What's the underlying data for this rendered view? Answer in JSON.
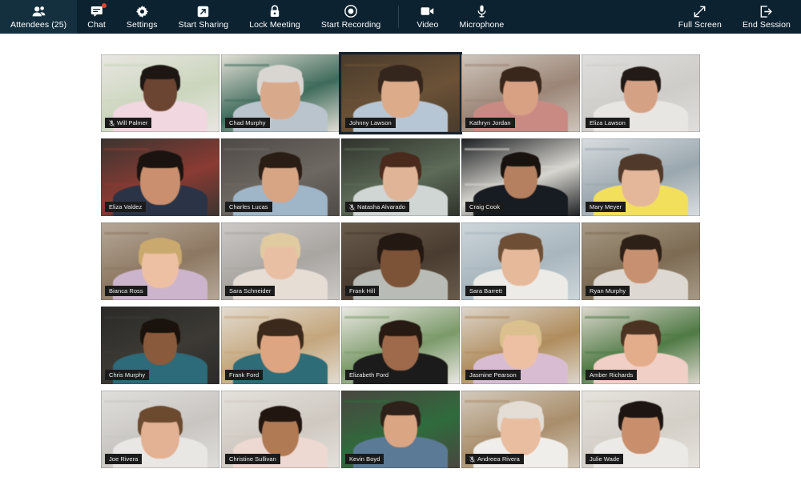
{
  "toolbar": {
    "background_color": "#0c2230",
    "left_items": [
      {
        "label": "Attendees (25)",
        "icon": "attendees-icon",
        "badge": false
      },
      {
        "label": "Chat",
        "icon": "chat-icon",
        "badge": true
      },
      {
        "label": "Settings",
        "icon": "gear-icon",
        "badge": false
      },
      {
        "label": "Start Sharing",
        "icon": "share-screen-icon",
        "badge": false
      },
      {
        "label": "Lock Meeting",
        "icon": "lock-icon",
        "badge": false
      },
      {
        "label": "Start Recording",
        "icon": "record-icon",
        "badge": false
      },
      {
        "label": "Video",
        "icon": "video-camera-icon",
        "badge": false
      },
      {
        "label": "Microphone",
        "icon": "microphone-icon",
        "badge": false
      }
    ],
    "right_items": [
      {
        "label": "Full Screen",
        "icon": "full-screen-icon"
      },
      {
        "label": "End Session",
        "icon": "exit-door-icon"
      }
    ],
    "badge_color": "#e8442e"
  },
  "participants": [
    {
      "name": "Will Palmer",
      "muted": true,
      "active": false,
      "bg": "#e9e6e2",
      "hair": "#1d1612",
      "skin": "#6b4432",
      "shirt": "#f0d7e0",
      "accent": "#cbd6bd"
    },
    {
      "name": "Chad Murphy",
      "muted": false,
      "active": false,
      "bg": "#e4e0d6",
      "hair": "#d9d6d2",
      "skin": "#d9a98c",
      "shirt": "#b9c4cd",
      "accent": "#3f6b5c"
    },
    {
      "name": "Johnny Lawson",
      "muted": false,
      "active": true,
      "bg": "#4a3b2c",
      "hair": "#34261c",
      "skin": "#dcab8a",
      "shirt": "#b7c6d4",
      "accent": "#6b5237"
    },
    {
      "name": "Kathryn Jordan",
      "muted": false,
      "active": false,
      "bg": "#cfc6bc",
      "hair": "#3a271c",
      "skin": "#d9a184",
      "shirt": "#c98a84",
      "accent": "#9b8577"
    },
    {
      "name": "Eliza Lawson",
      "muted": false,
      "active": false,
      "bg": "#dfdedc",
      "hair": "#221a16",
      "skin": "#d5a184",
      "shirt": "#e8e6e3",
      "accent": "#cfcdca"
    },
    {
      "name": "Eliza Valdez",
      "muted": false,
      "active": false,
      "bg": "#3b3531",
      "hair": "#1a1310",
      "skin": "#c98f6e",
      "shirt": "#2a3446",
      "accent": "#8a3b33"
    },
    {
      "name": "Charles Lucas",
      "muted": false,
      "active": false,
      "bg": "#4e4a46",
      "hair": "#2a1d16",
      "skin": "#d7a484",
      "shirt": "#9fb6c9",
      "accent": "#6e6862"
    },
    {
      "name": "Natasha Alvarado",
      "muted": true,
      "active": false,
      "bg": "#30332c",
      "hair": "#4a2a1c",
      "skin": "#e0b497",
      "shirt": "#cfd6d3",
      "accent": "#5d6b58"
    },
    {
      "name": "Craig Cook",
      "muted": false,
      "active": false,
      "bg": "#1d1f22",
      "hair": "#191310",
      "skin": "#b5805f",
      "shirt": "#171b22",
      "accent": "#d8d6d0"
    },
    {
      "name": "Mary Meyer",
      "muted": false,
      "active": false,
      "bg": "#d9dde0",
      "hair": "#50392a",
      "skin": "#e5b79a",
      "shirt": "#f2e05c",
      "accent": "#9aa7ae"
    },
    {
      "name": "Bianca Ross",
      "muted": false,
      "active": false,
      "bg": "#b6a898",
      "hair": "#c9a96e",
      "skin": "#edc0a4",
      "shirt": "#cdb4cd",
      "accent": "#8d7862"
    },
    {
      "name": "Sara Schneider",
      "muted": false,
      "active": false,
      "bg": "#ccc9c6",
      "hair": "#e0cba0",
      "skin": "#e9bfa4",
      "shirt": "#e6ddd5",
      "accent": "#a9a5a1"
    },
    {
      "name": "Frank Hill",
      "muted": false,
      "active": false,
      "bg": "#6a5c4c",
      "hair": "#241812",
      "skin": "#7d5337",
      "shirt": "#b9bcb6",
      "accent": "#4a3c30"
    },
    {
      "name": "Sara Barrett",
      "muted": false,
      "active": false,
      "bg": "#cdd6db",
      "hair": "#6e4f36",
      "skin": "#e6b99b",
      "shirt": "#ecebe8",
      "accent": "#a8b6bd"
    },
    {
      "name": "Ryan Murphy",
      "muted": false,
      "active": false,
      "bg": "#a79a86",
      "hair": "#2d2017",
      "skin": "#c79070",
      "shirt": "#ddd9d2",
      "accent": "#7d6b53"
    },
    {
      "name": "Chris Murphy",
      "muted": false,
      "active": false,
      "bg": "#2b2a28",
      "hair": "#1a120c",
      "skin": "#8a5a3c",
      "shirt": "#2d6a7a",
      "accent": "#3d3a35"
    },
    {
      "name": "Frank Ford",
      "muted": false,
      "active": false,
      "bg": "#e3ddd2",
      "hair": "#3b2a1c",
      "skin": "#dda582",
      "shirt": "#2e6d78",
      "accent": "#c4a67c"
    },
    {
      "name": "Elizabeth Ford",
      "muted": false,
      "active": false,
      "bg": "#ece9e4",
      "hair": "#261a12",
      "skin": "#9e6a4b",
      "shirt": "#1b1b1b",
      "accent": "#7b9a6a"
    },
    {
      "name": "Jasmine Pearson",
      "muted": false,
      "active": false,
      "bg": "#ddd6cc",
      "hair": "#d9c08c",
      "skin": "#eec0a3",
      "shirt": "#d8bdd2",
      "accent": "#b08d5e"
    },
    {
      "name": "Amber Richards",
      "muted": false,
      "active": false,
      "bg": "#ded8cf",
      "hair": "#4b3322",
      "skin": "#e3ad8c",
      "shirt": "#f0cfc6",
      "accent": "#4f7a45"
    },
    {
      "name": "Joe Rivera",
      "muted": false,
      "active": false,
      "bg": "#e0dedb",
      "hair": "#6b4a30",
      "skin": "#e3b193",
      "shirt": "#e9e7e4",
      "accent": "#c9c6c2"
    },
    {
      "name": "Christine Sullivan",
      "muted": false,
      "active": false,
      "bg": "#e4e1dc",
      "hair": "#221611",
      "skin": "#b07a55",
      "shirt": "#edd8d2",
      "accent": "#cfc9c1"
    },
    {
      "name": "Kevin Boyd",
      "muted": false,
      "active": false,
      "bg": "#4a4640",
      "hair": "#2e2119",
      "skin": "#d9a582",
      "shirt": "#5b7a96",
      "accent": "#2f6b3c"
    },
    {
      "name": "Andreea Rivera",
      "muted": true,
      "active": false,
      "bg": "#d3cabc",
      "hair": "#e3ddd6",
      "skin": "#e9bda0",
      "shirt": "#f0eeea",
      "accent": "#a98e6b"
    },
    {
      "name": "Julie Wade",
      "muted": false,
      "active": false,
      "bg": "#e6e3de",
      "hair": "#1d1511",
      "skin": "#c98f6c",
      "shirt": "#eceae6",
      "accent": "#d4cfc7"
    }
  ]
}
